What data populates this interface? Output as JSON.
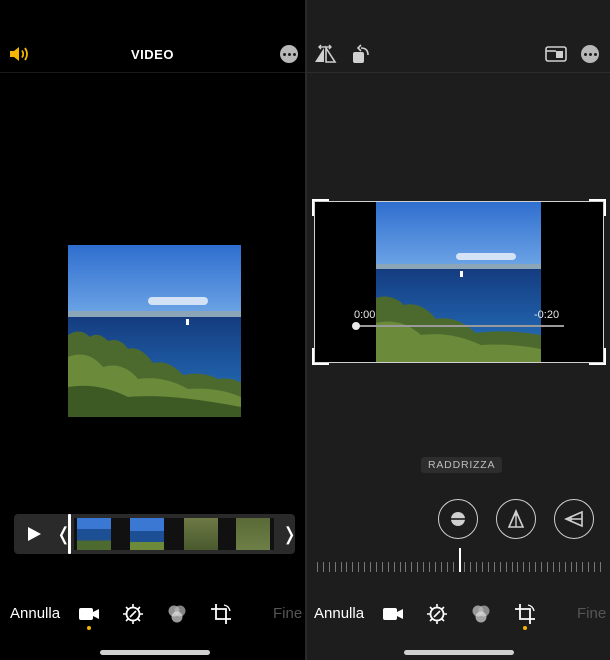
{
  "left": {
    "header": {
      "title": "VIDEO"
    },
    "icons": {
      "volume": "speaker-icon",
      "more": "more-icon"
    },
    "bottom": {
      "cancel_label": "Annulla",
      "done_label": "Fine"
    },
    "colors": {
      "accent": "#f3b700",
      "background": "#000000"
    }
  },
  "right": {
    "overlay": {
      "time_start": "0:00",
      "time_end": "-0:20"
    },
    "straighten_label": "RADDRIZZA",
    "bottom": {
      "cancel_label": "Annulla",
      "done_label": "Fine"
    },
    "colors": {
      "background": "#1d1d1d"
    }
  }
}
